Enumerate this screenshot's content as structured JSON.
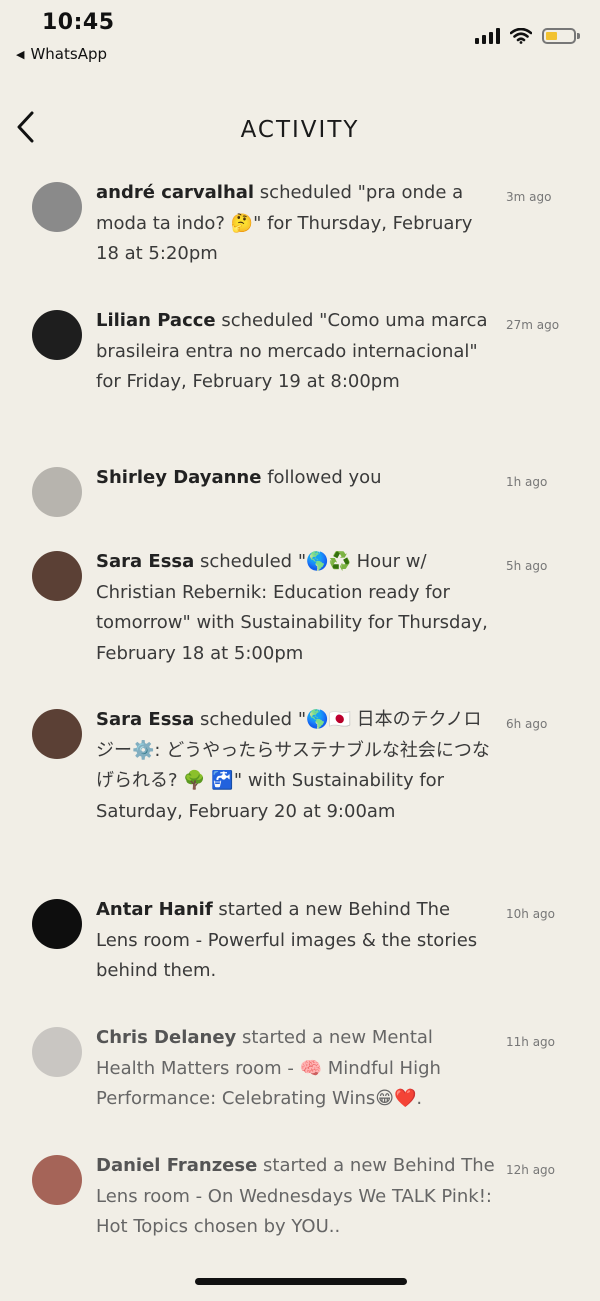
{
  "status_bar": {
    "time": "10:45",
    "back_app": "WhatsApp"
  },
  "nav": {
    "title": "ACTIVITY"
  },
  "feed": [
    {
      "name": "andré carvalhal",
      "text": " scheduled \"pra onde a moda ta indo? 🤔\" for Thursday, February 18 at 5:20pm",
      "time": "3m ago",
      "avatar_color": "#8a8a8a"
    },
    {
      "name": "Lilian Pacce",
      "text": " scheduled \"Como uma marca brasileira entra no mercado internacional\" for Friday, February 19 at 8:00pm",
      "time": "27m ago",
      "avatar_color": "#1e1e1e"
    },
    {
      "name": "Shirley Dayanne",
      "text": " followed you",
      "time": "1h ago",
      "avatar_color": "#b7b4ae"
    },
    {
      "name": "Sara Essa",
      "text": " scheduled \"🌎♻️ Hour w/ Christian Rebernik: Education ready for tomorrow\" with Sustainability for Thursday, February 18 at 5:00pm",
      "time": "5h ago",
      "avatar_color": "#5b4035"
    },
    {
      "name": "Sara Essa",
      "text": " scheduled \"🌎🇯🇵 日本のテクノロジー⚙️: どうやったらサステナブルな社会につなげられる? 🌳 🚰\" with Sustainability for Saturday, February 20 at 9:00am",
      "time": "6h ago",
      "avatar_color": "#5b4035"
    },
    {
      "name": "Antar Hanif",
      "text": " started a new Behind The Lens room - Powerful images & the stories behind them.",
      "time": "10h ago",
      "avatar_color": "#0e0e0e"
    },
    {
      "name": "Chris Delaney",
      "text": " started a new Mental Health Matters room - 🧠 Mindful High Performance: Celebrating Wins😁❤️.",
      "time": "11h ago",
      "avatar_color": "#c9c6c2",
      "faded": true
    },
    {
      "name": "Daniel Franzese",
      "text": " started a new Behind The Lens room - On Wednesdays We TALK Pink!: Hot Topics chosen by YOU..",
      "time": "12h ago",
      "avatar_color": "#a56458",
      "faded": true
    }
  ]
}
